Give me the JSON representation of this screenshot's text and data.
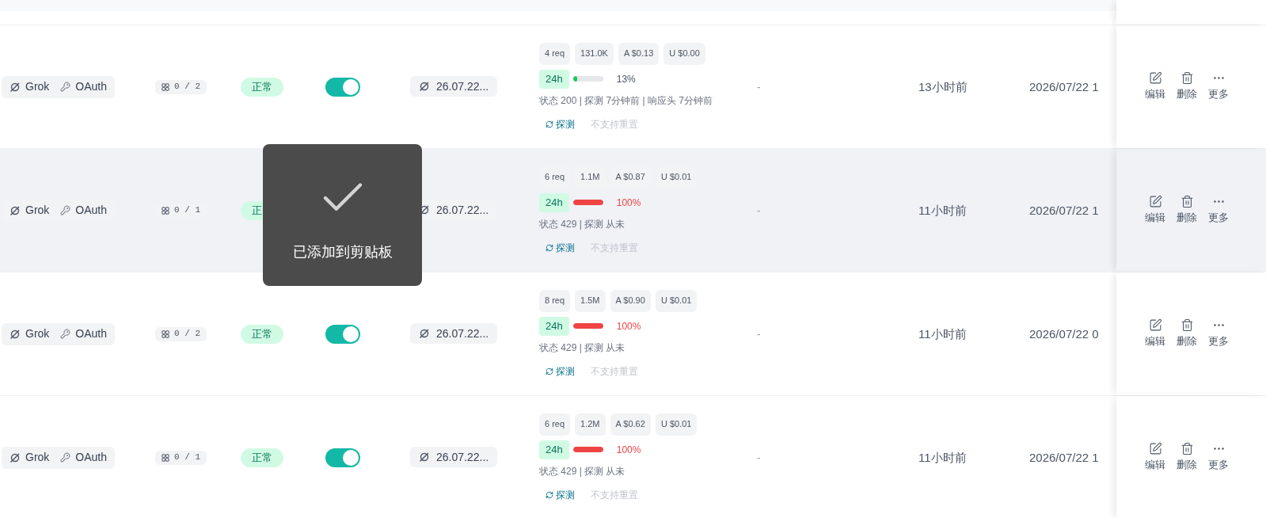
{
  "rows": [
    {
      "model": "Grok",
      "auth": "OAuth",
      "count": "0 / 2",
      "status": "正常",
      "enabled": true,
      "expiry": "26.07.22...",
      "usage": {
        "chips": [
          "4 req",
          "131.0K",
          "A $0.13",
          "U $0.00"
        ],
        "window": "24h",
        "level": 0.13,
        "percent": "13%",
        "detail": "状态 200 | 探测 7分钟前 | 响应头 7分钟前",
        "probe": "探测",
        "reset": {
          "label": "不支持重置",
          "disabled": true
        }
      },
      "note": "-",
      "last_used": "13小时前",
      "created": "2026/07/22 1",
      "hovered": false,
      "actions": [
        {
          "kind": "edit",
          "label": "编辑"
        },
        {
          "kind": "delete",
          "label": "删除"
        },
        {
          "kind": "more",
          "label": "更多"
        }
      ]
    },
    {
      "model": "Grok",
      "auth": "OAuth",
      "count": "0 / 1",
      "status": "正",
      "expiry": "26.07.22...",
      "usage": {
        "chips": [
          "6 req",
          "1.1M",
          "A $0.87",
          "U $0.01"
        ],
        "window": "24h",
        "level": 1,
        "percent": "100%",
        "detail": "状态 429 | 探测 从未",
        "probe": "探测",
        "reset": {
          "label": "不支持重置",
          "disabled": true
        }
      },
      "note": "-",
      "last_used": "11小时前",
      "created": "2026/07/22 1",
      "hovered": true,
      "actions": [
        {
          "kind": "edit",
          "label": "编辑"
        },
        {
          "kind": "delete",
          "label": "删除"
        },
        {
          "kind": "more",
          "label": "更多"
        }
      ]
    },
    {
      "model": "Grok",
      "auth": "OAuth",
      "count": "0 / 2",
      "status": "正常",
      "enabled": true,
      "expiry": "26.07.22...",
      "usage": {
        "chips": [
          "8 req",
          "1.5M",
          "A $0.90",
          "U $0.01"
        ],
        "window": "24h",
        "level": 1,
        "percent": "100%",
        "detail": "状态 429 | 探测 从未",
        "probe": "探测",
        "reset": {
          "label": "不支持重置",
          "disabled": true
        }
      },
      "note": "-",
      "last_used": "11小时前",
      "created": "2026/07/22 0",
      "hovered": false,
      "actions": [
        {
          "kind": "edit",
          "label": "编辑"
        },
        {
          "kind": "delete",
          "label": "删除"
        },
        {
          "kind": "more",
          "label": "更多"
        }
      ]
    },
    {
      "model": "Grok",
      "auth": "OAuth",
      "count": "0 / 1",
      "status": "正常",
      "enabled": true,
      "expiry": "26.07.22...",
      "usage": {
        "chips": [
          "6 req",
          "1.2M",
          "A $0.62",
          "U $0.01"
        ],
        "window": "24h",
        "level": 1,
        "percent": "100%",
        "detail": "状态 429 | 探测 从未",
        "probe": "探测",
        "reset": {
          "label": "不支持重置",
          "disabled": true
        }
      },
      "note": "-",
      "last_used": "11小时前",
      "created": "2026/07/22 1",
      "hovered": false,
      "actions": [
        {
          "kind": "edit",
          "label": "编辑"
        },
        {
          "kind": "delete",
          "label": "删除"
        },
        {
          "kind": "more",
          "label": "更多"
        }
      ]
    }
  ],
  "toast": {
    "text": "已添加到剪贴板"
  }
}
